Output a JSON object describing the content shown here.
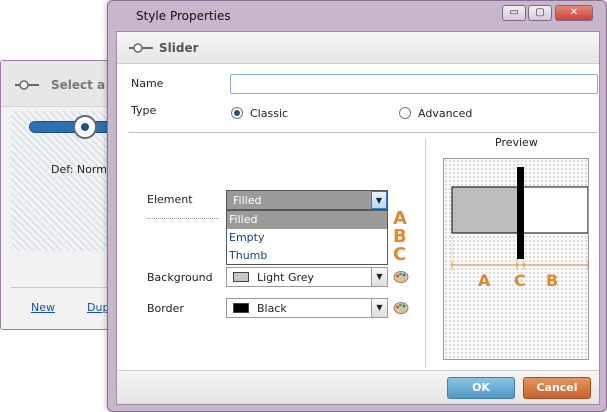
{
  "background_window": {
    "title": "Select a",
    "default_text": "Def: Norma",
    "links": [
      "New",
      "Dup"
    ]
  },
  "dialog": {
    "title": "Style Properties",
    "window_buttons": {
      "minimize": "▭",
      "restore": "▢",
      "close": "✕"
    },
    "section_title": "Slider",
    "name_label": "Name",
    "name_value": "",
    "type_label": "Type",
    "type_options": [
      {
        "label": "Classic",
        "selected": true
      },
      {
        "label": "Advanced",
        "selected": false
      }
    ],
    "element_label": "Element",
    "element_value": "Filled",
    "element_options": [
      "Filled",
      "Empty",
      "Thumb"
    ],
    "element_letters": [
      "A",
      "B",
      "C"
    ],
    "background_label": "Background",
    "background_value": "Light Grey",
    "background_color": "#c8c8c8",
    "border_label": "Border",
    "border_value": "Black",
    "border_color": "#000000",
    "preview": {
      "label": "Preview",
      "letters": [
        "A",
        "C",
        "B"
      ]
    },
    "ok_label": "OK",
    "cancel_label": "Cancel"
  },
  "colors": {
    "accent_orange": "#e08a2c",
    "ok_blue": "#4f98c6",
    "cancel_orange": "#c8612c",
    "selection_grey": "#9b9b9b"
  },
  "icons": {
    "section": "slider-icon",
    "palette": "palette-icon"
  }
}
